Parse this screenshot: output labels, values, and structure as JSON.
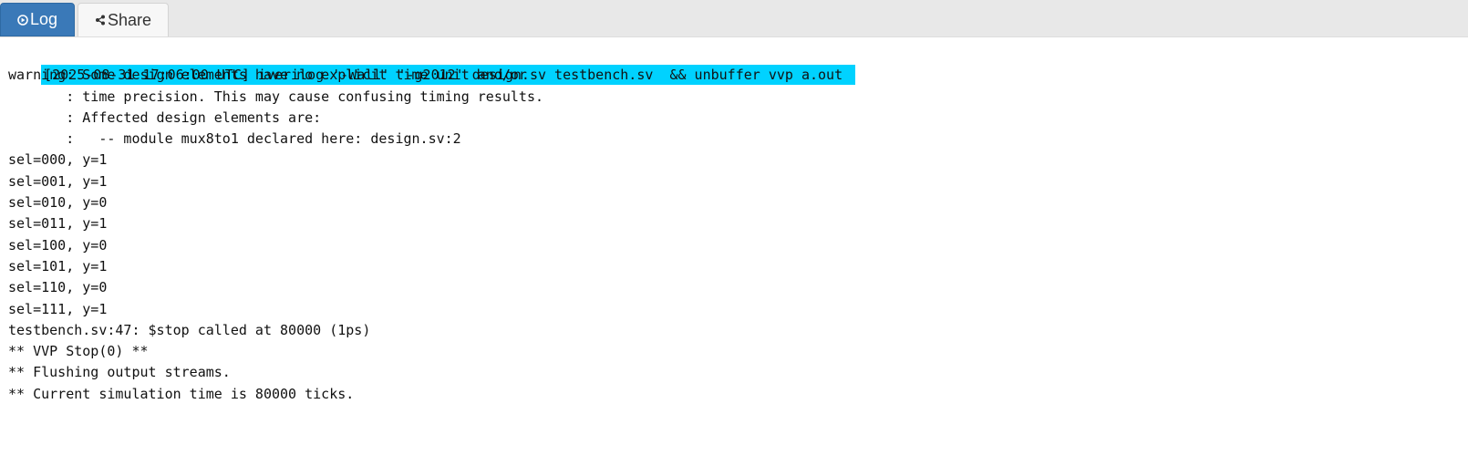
{
  "tabs": {
    "log": {
      "label": "Log",
      "icon": "play-circle-icon",
      "active": true,
      "color": "#3a79b8"
    },
    "share": {
      "label": "Share",
      "icon": "share-icon",
      "active": false
    }
  },
  "log": {
    "command": "[2025-08-31 17:06:00 UTC] iverilog '-Wall' '-g2012' design.sv testbench.sv  && unbuffer vvp a.out",
    "command_highlight_color": "#00d2ff",
    "lines": [
      "warning: Some design elements have no explicit time unit and/or",
      "       : time precision. This may cause confusing timing results.",
      "       : Affected design elements are:",
      "       :   -- module mux8to1 declared here: design.sv:2",
      "sel=000, y=1",
      "sel=001, y=1",
      "sel=010, y=0",
      "sel=011, y=1",
      "sel=100, y=0",
      "sel=101, y=1",
      "sel=110, y=0",
      "sel=111, y=1",
      "testbench.sv:47: $stop called at 80000 (1ps)",
      "** VVP Stop(0) **",
      "** Flushing output streams.",
      "** Current simulation time is 80000 ticks."
    ]
  }
}
